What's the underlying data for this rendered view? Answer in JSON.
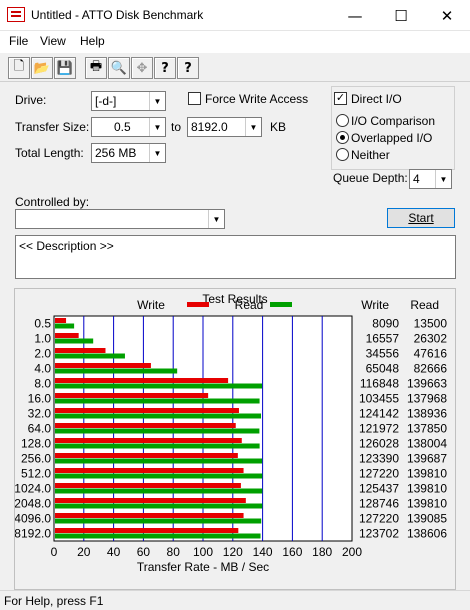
{
  "window": {
    "title": "Untitled - ATTO Disk Benchmark",
    "minimize": "—",
    "maximize": "☐",
    "close": "✕"
  },
  "menu": [
    "File",
    "View",
    "Help"
  ],
  "toolbar": {
    "icons": [
      "new-file-icon",
      "open-folder-icon",
      "save-icon",
      "print-icon",
      "print-preview-icon",
      "move-icon",
      "help-icon",
      "context-help-icon"
    ],
    "glyphs": [
      "🗋",
      "📂",
      "💾",
      "🖶",
      "🔍",
      "✥",
      "?",
      "?"
    ]
  },
  "form": {
    "drive_label": "Drive:",
    "drive_value": "[-d-]",
    "force_write_label": "Force Write Access",
    "direct_io_label": "Direct I/O",
    "transfer_size_label": "Transfer Size:",
    "transfer_from": "0.5",
    "to_label": "to",
    "transfer_to": "8192.0",
    "kb_label": "KB",
    "total_length_label": "Total Length:",
    "total_length_value": "256 MB",
    "io_comparison_label": "I/O Comparison",
    "overlapped_io_label": "Overlapped I/O",
    "neither_label": "Neither",
    "queue_depth_label": "Queue Depth:",
    "queue_depth_value": "4",
    "controlled_by_label": "Controlled by:",
    "controlled_by_value": "",
    "start_label": "Start",
    "description_text": "<< Description >>"
  },
  "status": "For Help, press F1",
  "chart_data": {
    "type": "bar",
    "title": "Test Results",
    "xlabel": "Transfer Rate - MB / Sec",
    "xlim": [
      0,
      200
    ],
    "x_ticks": [
      0,
      20,
      40,
      60,
      80,
      100,
      120,
      140,
      160,
      180,
      200
    ],
    "grid": true,
    "legend_position": "top",
    "categories": [
      "0.5",
      "1.0",
      "2.0",
      "4.0",
      "8.0",
      "16.0",
      "32.0",
      "64.0",
      "128.0",
      "256.0",
      "512.0",
      "1024.0",
      "2048.0",
      "4096.0",
      "8192.0"
    ],
    "series": [
      {
        "name": "Write",
        "color": "#e60000",
        "values": [
          8090,
          16557,
          34556,
          65048,
          116848,
          103455,
          124142,
          121972,
          126028,
          123390,
          127220,
          125437,
          128746,
          127220,
          123702
        ]
      },
      {
        "name": "Read",
        "color": "#00a000",
        "values": [
          13500,
          26302,
          47616,
          82666,
          139663,
          137968,
          138936,
          137850,
          138004,
          139687,
          139810,
          139810,
          139810,
          139085,
          138606
        ]
      }
    ],
    "table_headers": {
      "write": "Write",
      "read": "Read"
    }
  }
}
